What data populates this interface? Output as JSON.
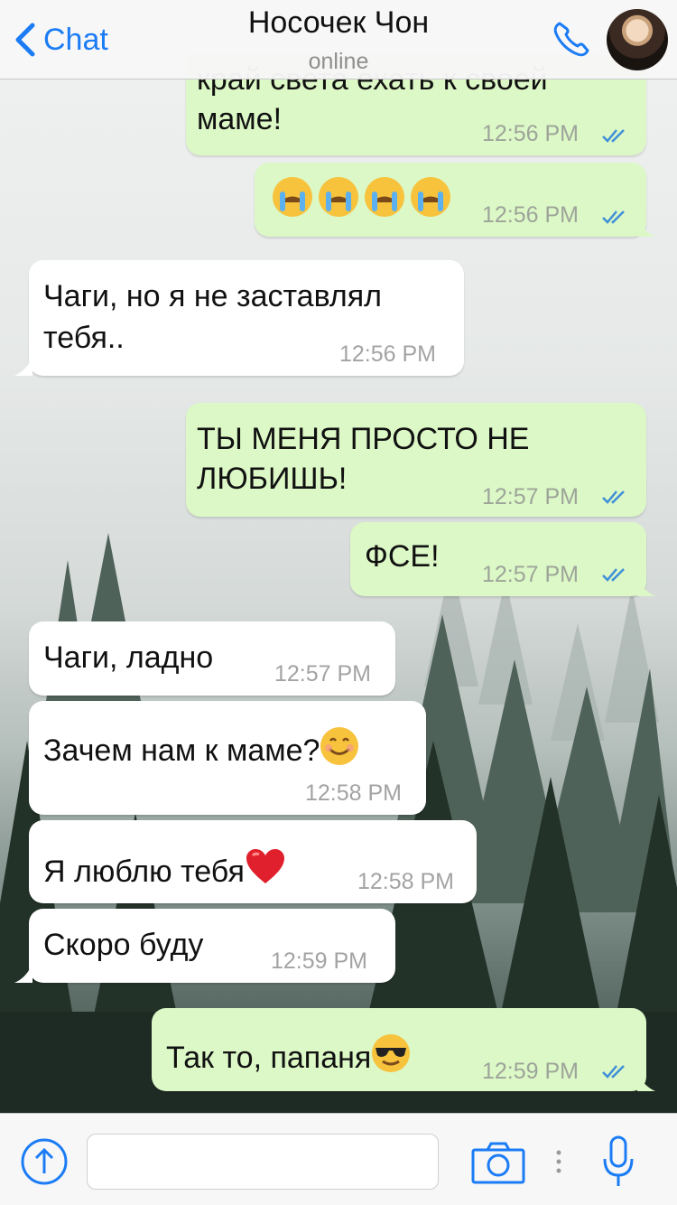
{
  "header": {
    "back_label": "Chat",
    "contact_name": "Носочек Чон",
    "status": "online"
  },
  "messages": [
    {
      "dir": "out",
      "text_lines": [
        "край света ехать к своей",
        "маме!"
      ],
      "time": "12:56 PM",
      "read": true
    },
    {
      "dir": "out",
      "text": "😭😭😭😭",
      "time": "12:56 PM",
      "read": true
    },
    {
      "dir": "in",
      "text_lines": [
        "Чаги, но я не заставлял",
        "тебя.."
      ],
      "time": "12:56 PM"
    },
    {
      "dir": "out",
      "text_lines": [
        "ТЫ МЕНЯ ПРОСТО НЕ",
        "ЛЮБИШЬ!"
      ],
      "time": "12:57 PM",
      "read": true
    },
    {
      "dir": "out",
      "text": "ФСЕ!",
      "time": "12:57 PM",
      "read": true
    },
    {
      "dir": "in",
      "text": "Чаги, ладно",
      "time": "12:57 PM"
    },
    {
      "dir": "in",
      "text": "Зачем нам к маме?",
      "emoji": "smiling-face-icon",
      "time": "12:58 PM"
    },
    {
      "dir": "in",
      "text": "Я люблю тебя",
      "emoji": "red-heart-icon",
      "time": "12:58 PM"
    },
    {
      "dir": "in",
      "text": "Скоро буду",
      "time": "12:59 PM"
    },
    {
      "dir": "out",
      "text": "Так то, папаня",
      "emoji": "sunglasses-face-icon",
      "time": "12:59 PM",
      "read": true
    }
  ],
  "input": {
    "placeholder": ""
  },
  "colors": {
    "accent": "#1b7cf5",
    "outgoing_bubble": "#dcf8c6",
    "incoming_bubble": "#ffffff",
    "read_ticks": "#3f8fd8"
  },
  "icons": {
    "back": "chevron-left-icon",
    "call": "phone-icon",
    "attach": "upload-arrow-icon",
    "camera": "camera-icon",
    "mic": "microphone-icon"
  }
}
